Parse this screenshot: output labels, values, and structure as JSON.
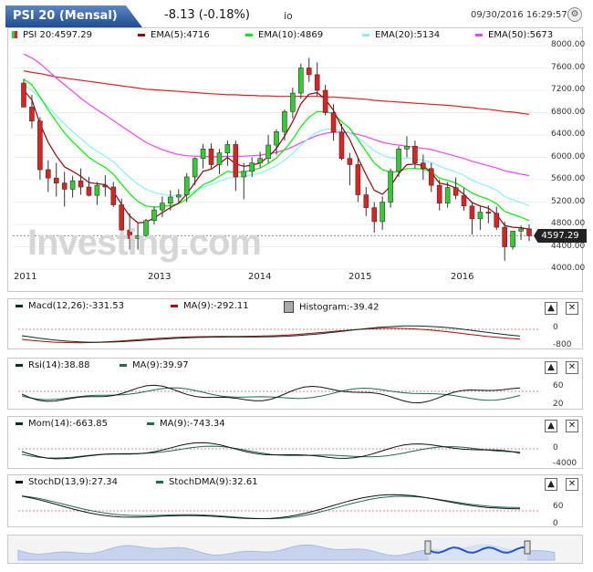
{
  "header": {
    "symbol": "PSI 20 (Mensal)",
    "change": "-8.13 (-0.18%)",
    "source": "io",
    "datetime": "09/30/2016 16:29:57"
  },
  "colors": {
    "up": "#33cc33",
    "down": "#dd2222",
    "ema5": "#990000",
    "ema10": "#00ee00",
    "ema20": "#88eeff",
    "ema50": "#ee44ee",
    "ema200": "#dd2222"
  },
  "main_legend": {
    "psi": "PSI 20:4597.29",
    "ema5": "EMA(5):4716",
    "ema10": "EMA(10):4869",
    "ema20": "EMA(20):5134",
    "ema50": "EMA(50):5673"
  },
  "main_yaxis": [
    "8000.00",
    "7600.00",
    "7200.00",
    "6800.00",
    "6400.00",
    "6000.00",
    "5600.00",
    "5200.00",
    "4800.00",
    "4400.00",
    "4000.00"
  ],
  "price_tag": "4597.29",
  "watermark": "Investing.com",
  "xaxis": [
    "2011",
    "2013",
    "2014",
    "2015",
    "2016"
  ],
  "macd": {
    "label1": "Macd(12,26):-331.53",
    "label2": "MA(9):-292.11",
    "label3": "Histogram:-39.42",
    "ticks": [
      "0",
      "-800"
    ]
  },
  "rsi": {
    "label1": "Rsi(14):38.88",
    "label2": "MA(9):39.97",
    "ticks": [
      "60",
      "20"
    ]
  },
  "mom": {
    "label1": "Mom(14):-663.85",
    "label2": "MA(9):-743.34",
    "ticks": [
      "0",
      "-4000"
    ]
  },
  "stoch": {
    "label1": "StochD(13,9):27.34",
    "label2": "StochDMA(9):32.61",
    "ticks": [
      "60",
      "0"
    ]
  },
  "buttons": {
    "up": "▲",
    "close": "✕"
  },
  "chart_data": {
    "type": "candlestick",
    "title": "PSI 20 (Mensal)",
    "x_range": [
      "2010-10",
      "2016-09"
    ],
    "ylim": [
      4000,
      8000
    ],
    "ohlc": [
      [
        7330,
        7400,
        6980,
        6900
      ],
      [
        6900,
        7120,
        6520,
        6650
      ],
      [
        6650,
        6720,
        5600,
        5780
      ],
      [
        5780,
        5950,
        5380,
        5630
      ],
      [
        5630,
        5900,
        5300,
        5540
      ],
      [
        5540,
        5740,
        5120,
        5430
      ],
      [
        5430,
        5670,
        5280,
        5580
      ],
      [
        5580,
        5800,
        5330,
        5470
      ],
      [
        5470,
        5650,
        5300,
        5320
      ],
      [
        5320,
        5560,
        5150,
        5500
      ],
      [
        5500,
        5680,
        5300,
        5470
      ],
      [
        5470,
        5560,
        5110,
        5150
      ],
      [
        5150,
        5260,
        4500,
        4700
      ],
      [
        4700,
        5000,
        4350,
        4550
      ],
      [
        4550,
        4820,
        4350,
        4600
      ],
      [
        4600,
        4900,
        4550,
        4870
      ],
      [
        4870,
        5120,
        4800,
        5060
      ],
      [
        5060,
        5300,
        4930,
        5180
      ],
      [
        5180,
        5410,
        5050,
        5290
      ],
      [
        5290,
        5430,
        5200,
        5330
      ],
      [
        5330,
        5720,
        5200,
        5650
      ],
      [
        5650,
        6000,
        5500,
        5980
      ],
      [
        5980,
        6240,
        5800,
        6150
      ],
      [
        6150,
        6250,
        5800,
        5870
      ],
      [
        5870,
        6150,
        5700,
        6080
      ],
      [
        6080,
        6300,
        5850,
        6230
      ],
      [
        6230,
        6300,
        5400,
        5650
      ],
      [
        5650,
        5900,
        5250,
        5750
      ],
      [
        5750,
        6000,
        5650,
        5900
      ],
      [
        5900,
        6100,
        5820,
        5980
      ],
      [
        5980,
        6400,
        5900,
        6220
      ],
      [
        6220,
        6500,
        6050,
        6460
      ],
      [
        6460,
        6860,
        6300,
        6820
      ],
      [
        6820,
        7250,
        6700,
        7150
      ],
      [
        7150,
        7680,
        7050,
        7600
      ],
      [
        7600,
        7780,
        7350,
        7480
      ],
      [
        7480,
        7700,
        7100,
        7200
      ],
      [
        7200,
        7300,
        6750,
        6800
      ],
      [
        6800,
        6950,
        6300,
        6450
      ],
      [
        6450,
        6600,
        5950,
        5980
      ],
      [
        5980,
        6080,
        5500,
        5870
      ],
      [
        5870,
        6000,
        5200,
        5330
      ],
      [
        5330,
        5470,
        4950,
        5100
      ],
      [
        5100,
        5200,
        4650,
        4850
      ],
      [
        4850,
        5300,
        4700,
        5200
      ],
      [
        5200,
        5800,
        5100,
        5750
      ],
      [
        5750,
        6200,
        5650,
        6150
      ],
      [
        6150,
        6380,
        6000,
        6200
      ],
      [
        6200,
        6300,
        5800,
        5900
      ],
      [
        5900,
        6050,
        5600,
        5800
      ],
      [
        5800,
        5900,
        5380,
        5500
      ],
      [
        5500,
        5600,
        5050,
        5180
      ],
      [
        5180,
        5560,
        5100,
        5460
      ],
      [
        5460,
        5640,
        5250,
        5320
      ],
      [
        5320,
        5450,
        5050,
        5130
      ],
      [
        5130,
        5200,
        4620,
        4900
      ],
      [
        4900,
        5120,
        4700,
        5020
      ],
      [
        5020,
        5140,
        4820,
        5000
      ],
      [
        5000,
        5120,
        4700,
        4750
      ],
      [
        4750,
        4850,
        4150,
        4400
      ],
      [
        4400,
        4680,
        4350,
        4680
      ],
      [
        4680,
        4780,
        4520,
        4720
      ],
      [
        4720,
        4800,
        4500,
        4597
      ]
    ],
    "series": [
      {
        "name": "EMA(5)",
        "values": [
          7200,
          7030,
          6600,
          6270,
          6030,
          5830,
          5750,
          5660,
          5550,
          5530,
          5510,
          5390,
          5160,
          4950,
          4830,
          4840,
          4920,
          5010,
          5100,
          5180,
          5340,
          5550,
          5750,
          5790,
          5890,
          6000,
          5880,
          5840,
          5860,
          5900,
          6010,
          6160,
          6380,
          6640,
          6960,
          7130,
          7160,
          7040,
          6840,
          6550,
          6320,
          5990,
          5690,
          5410,
          5340,
          5480,
          5710,
          5870,
          5880,
          5850,
          5730,
          5540,
          5510,
          5450,
          5340,
          5190,
          5130,
          5090,
          4980,
          4780,
          4750,
          4740,
          4716
        ]
      },
      {
        "name": "EMA(10)",
        "values": [
          7400,
          7300,
          7080,
          6850,
          6640,
          6440,
          6280,
          6140,
          6000,
          5900,
          5820,
          5700,
          5520,
          5350,
          5210,
          5130,
          5110,
          5120,
          5140,
          5170,
          5250,
          5380,
          5510,
          5570,
          5660,
          5750,
          5730,
          5740,
          5770,
          5810,
          5890,
          5990,
          6140,
          6320,
          6550,
          6720,
          6820,
          6820,
          6780,
          6640,
          6520,
          6320,
          6110,
          5900,
          5780,
          5730,
          5750,
          5800,
          5800,
          5790,
          5740,
          5630,
          5590,
          5540,
          5460,
          5360,
          5300,
          5250,
          5170,
          5030,
          4980,
          4930,
          4869
        ]
      },
      {
        "name": "EMA(20)",
        "values": [
          7300,
          7200,
          7060,
          6900,
          6750,
          6600,
          6460,
          6340,
          6210,
          6110,
          6020,
          5920,
          5780,
          5640,
          5520,
          5430,
          5370,
          5340,
          5320,
          5310,
          5340,
          5400,
          5470,
          5520,
          5570,
          5630,
          5640,
          5660,
          5690,
          5720,
          5780,
          5850,
          5950,
          6070,
          6220,
          6350,
          6450,
          6500,
          6510,
          6480,
          6440,
          6350,
          6240,
          6120,
          6040,
          5990,
          5980,
          5980,
          5970,
          5950,
          5910,
          5840,
          5790,
          5740,
          5680,
          5590,
          5530,
          5480,
          5410,
          5300,
          5240,
          5190,
          5134
        ]
      },
      {
        "name": "EMA(50)",
        "values": [
          7850,
          7780,
          7680,
          7550,
          7420,
          7300,
          7180,
          7060,
          6950,
          6850,
          6760,
          6660,
          6560,
          6460,
          6360,
          6270,
          6200,
          6140,
          6090,
          6050,
          6030,
          6020,
          6020,
          6010,
          6010,
          6020,
          6020,
          6020,
          6030,
          6040,
          6060,
          6090,
          6130,
          6190,
          6260,
          6330,
          6390,
          6430,
          6450,
          6450,
          6440,
          6410,
          6370,
          6320,
          6270,
          6240,
          6220,
          6200,
          6180,
          6160,
          6140,
          6100,
          6060,
          6020,
          5980,
          5930,
          5890,
          5850,
          5810,
          5760,
          5730,
          5700,
          5673
        ]
      },
      {
        "name": "EMA(200)",
        "values": [
          7550,
          7520,
          7500,
          7470,
          7440,
          7420,
          7400,
          7380,
          7360,
          7340,
          7320,
          7300,
          7280,
          7260,
          7240,
          7220,
          7210,
          7200,
          7190,
          7180,
          7170,
          7160,
          7150,
          7140,
          7130,
          7120,
          7120,
          7110,
          7110,
          7100,
          7100,
          7090,
          7090,
          7090,
          7090,
          7090,
          7090,
          7080,
          7080,
          7070,
          7060,
          7050,
          7040,
          7020,
          7010,
          7000,
          6990,
          6980,
          6970,
          6960,
          6950,
          6940,
          6930,
          6920,
          6900,
          6890,
          6870,
          6860,
          6840,
          6820,
          6810,
          6790,
          6770
        ]
      }
    ]
  }
}
